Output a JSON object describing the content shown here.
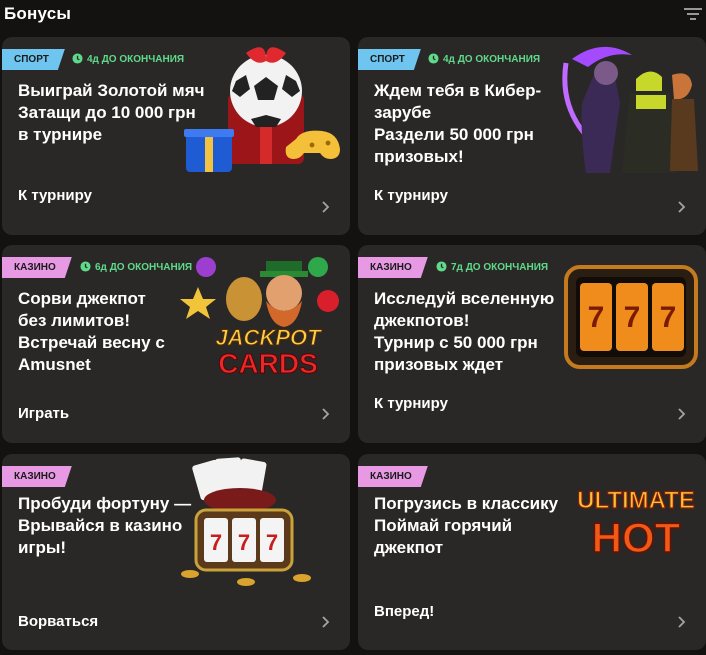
{
  "header": {
    "title": "Бонусы"
  },
  "cards": [
    {
      "tag": "СПОРТ",
      "timer": "4д ДО ОКОНЧАНИЯ",
      "lines": [
        "Выиграй Золотой мяч",
        "Затащи до 10 000 грн",
        "в турнире"
      ],
      "cta": "К турниру"
    },
    {
      "tag": "СПОРТ",
      "timer": "4д ДО ОКОНЧАНИЯ",
      "lines": [
        "Ждем тебя в Кибер-",
        "зарубе",
        "Раздели 50 000 грн",
        "призовых!"
      ],
      "cta": "К турниру"
    },
    {
      "tag": "КАЗИНО",
      "timer": "6д ДО ОКОНЧАНИЯ",
      "lines": [
        "Сорви джекпот",
        "без лимитов!",
        "Встречай весну с",
        "Amusnet"
      ],
      "cta": "Играть",
      "art_text": [
        "JACKPOT",
        "CARDS"
      ]
    },
    {
      "tag": "КАЗИНО",
      "timer": "7д ДО ОКОНЧАНИЯ",
      "lines": [
        "Исследуй вселенную",
        "джекпотов!",
        "Турнир с 50 000 грн",
        "призовых ждет"
      ],
      "cta": "К турниру"
    },
    {
      "tag": "КАЗИНО",
      "timer": "",
      "lines": [
        "Пробуди фортуну —",
        "Врывайся в казино",
        "игры!"
      ],
      "cta": "Ворваться"
    },
    {
      "tag": "КАЗИНО",
      "timer": "",
      "lines": [
        "Погрузись в классику",
        "Поймай горячий",
        "джекпот"
      ],
      "cta": "Вперед!",
      "art_text": [
        "ULTIMATE",
        "HOT"
      ]
    }
  ],
  "colors": {
    "background": "#141210",
    "card": "#2a2826",
    "sport_tag": "#6ec6f0",
    "casino_tag": "#e79ae3",
    "timer": "#5fd98a"
  },
  "icons": [
    "filter-icon",
    "clock-icon",
    "chevron-right-icon"
  ]
}
